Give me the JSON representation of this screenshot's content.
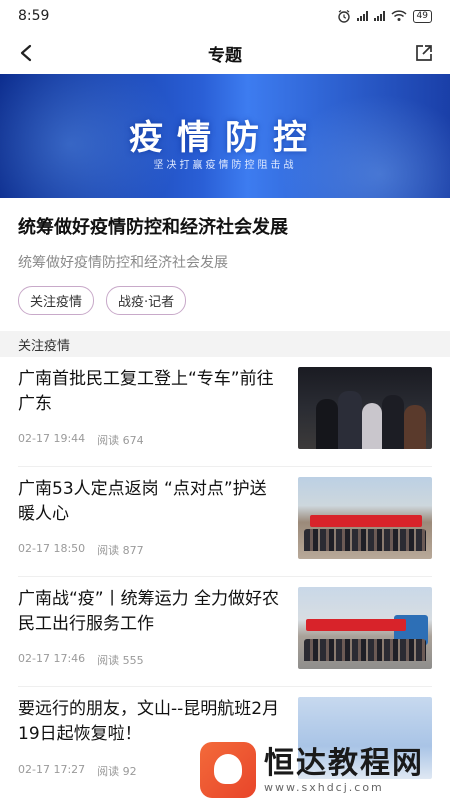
{
  "status_bar": {
    "time": "8:59",
    "battery": "49"
  },
  "nav": {
    "title": "专题",
    "back_icon": "back-arrow-icon",
    "share_icon": "share-icon"
  },
  "banner": {
    "title": "疫情防控",
    "subtitle": "坚决打赢疫情防控阻击战"
  },
  "topic": {
    "title": "统筹做好疫情防控和经济社会发展",
    "description": "统筹做好疫情防控和经济社会发展",
    "tags": [
      "关注疫情",
      "战疫·记者"
    ]
  },
  "section": {
    "title": "关注疫情"
  },
  "news": [
    {
      "title": "广南首批民工复工登上“专车”前往广东",
      "date": "02-17 19:44",
      "reads": "阅读 674"
    },
    {
      "title": "广南53人定点返岗 “点对点”护送暖人心",
      "date": "02-17 18:50",
      "reads": "阅读 877"
    },
    {
      "title": "广南战“疫”丨统筹运力 全力做好农民工出行服务工作",
      "date": "02-17 17:46",
      "reads": "阅读 555"
    },
    {
      "title": "要远行的朋友，文山--昆明航班2月19日起恢复啦！",
      "date": "02-17 17:27",
      "reads": "阅读 92"
    }
  ],
  "watermark": {
    "name": "恒达教程网",
    "url": "www.sxhdcj.com"
  }
}
